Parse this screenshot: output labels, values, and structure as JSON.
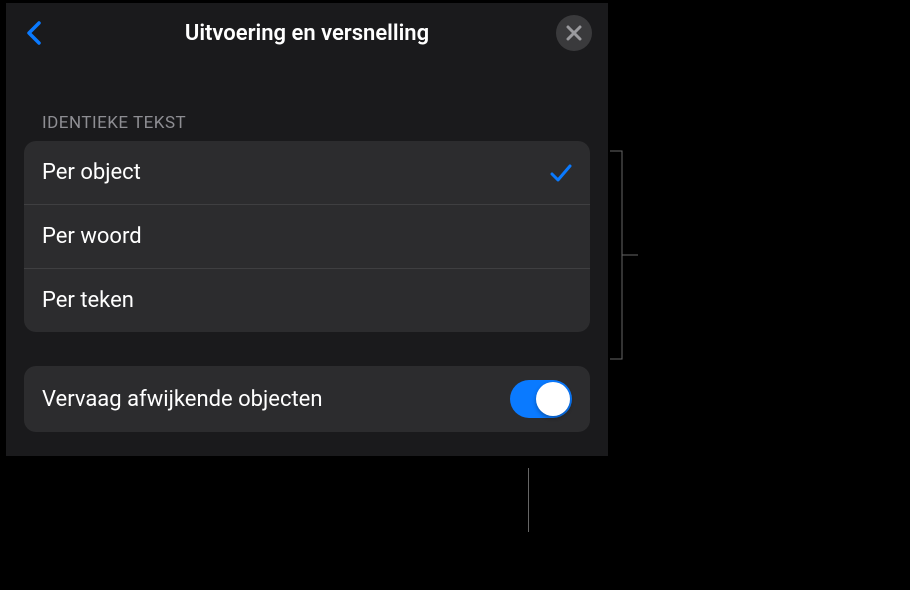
{
  "header": {
    "title": "Uitvoering en versnelling"
  },
  "section": {
    "header": "IDENTIEKE TEKST",
    "options": [
      {
        "label": "Per object",
        "selected": true
      },
      {
        "label": "Per woord",
        "selected": false
      },
      {
        "label": "Per teken",
        "selected": false
      }
    ]
  },
  "toggle": {
    "label": "Vervaag afwijkende objecten",
    "enabled": true
  }
}
